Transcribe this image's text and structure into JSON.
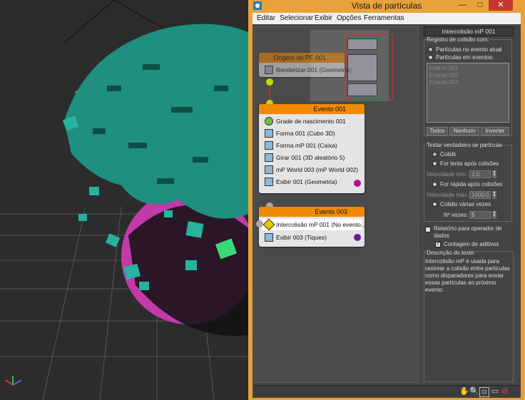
{
  "window": {
    "title": "Vista de partículas"
  },
  "menu": [
    "Editar",
    "Selecionar",
    "Exibir",
    "Opções",
    "Ferramentas"
  ],
  "ghost_node": {
    "title": "Origem do PF 001",
    "op": "Renderizar 001 (Geometria)"
  },
  "event1": {
    "title": "Evento 001",
    "ops": [
      {
        "label": "Grade de nascimento 001",
        "icon": "grid-birth-icon"
      },
      {
        "label": "Forma 001 (Cubo 3D)",
        "icon": "shape-icon"
      },
      {
        "label": "Forma mP 001 (Caixa)",
        "icon": "mp-shape-icon"
      },
      {
        "label": "Girar 001 (3D aleatório 5)",
        "icon": "spin-icon"
      },
      {
        "label": "mP World 003 (mP World 002)",
        "icon": "mp-world-icon"
      },
      {
        "label": "Exibir 001 (Geometria)",
        "icon": "display-icon"
      }
    ]
  },
  "event3": {
    "title": "Evento 003",
    "ops": [
      {
        "label": "Intercolisão mP 001 (No evento...",
        "icon": "collision-test-icon"
      },
      {
        "label": "Exibir 003 (Tiques)",
        "icon": "display-icon"
      }
    ]
  },
  "panel": {
    "title": "Intercolisão mP 001",
    "registry_label": "Registro de colisão com:",
    "radio_current": "Partículas no evento atual",
    "radio_events": "Partículas em eventos:",
    "list_items": [
      "Evento 001",
      "Evento 002",
      "Evento 003"
    ],
    "btn_all": "Todos",
    "btn_none": "Nenhum",
    "btn_invert": "Inverter",
    "test_label": "Testar verdadeiro se partícula",
    "opt_collides": "Colidir",
    "opt_slow": "For lenta após colisões",
    "speed_min_label": "Velocidade mín.:",
    "speed_min_value": "1,0",
    "opt_fast": "For rápida após colisões",
    "speed_max_label": "Velocidade máx.:",
    "speed_max_value": "1000,0",
    "opt_multi": "Colidiu várias vezes",
    "times_label": "Nº vezes:",
    "times_value": "5",
    "chk_report": "Relatório para operador de dados",
    "chk_additive": "Contagem de aditivos"
  },
  "description": {
    "title": "Descrição do teste:",
    "text": "Intercolisão mP é usada para rastrear a colisão entre partículas como disparadores para enviar essas partículas ao próximo evento."
  },
  "colors": {
    "accent": "#f28a00",
    "frame": "#e9a23b",
    "particles": "#1f8f80",
    "sphere": "#c23aa8"
  }
}
